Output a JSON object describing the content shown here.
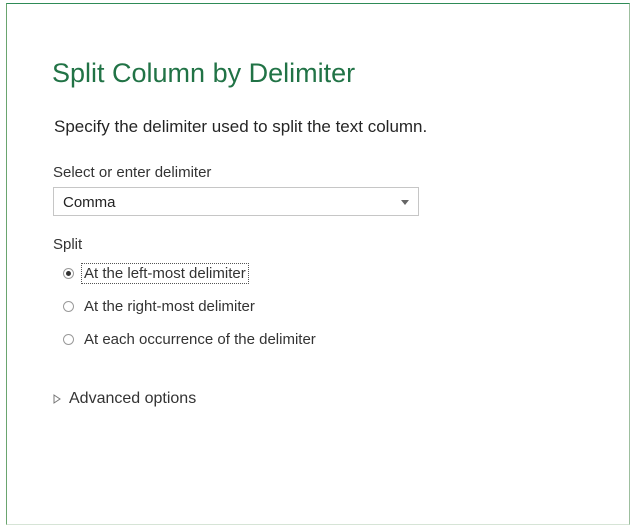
{
  "dialog": {
    "title": "Split Column by Delimiter",
    "description": "Specify the delimiter used to split the text column."
  },
  "delimiter": {
    "label": "Select or enter delimiter",
    "selected_value": "Comma"
  },
  "split": {
    "label": "Split",
    "options": [
      {
        "label": "At the left-most delimiter",
        "checked": true
      },
      {
        "label": "At the right-most delimiter",
        "checked": false
      },
      {
        "label": "At each occurrence of the delimiter",
        "checked": false
      }
    ]
  },
  "advanced": {
    "label": "Advanced options",
    "expanded": false
  },
  "colors": {
    "title": "#217346",
    "border_accent": "#2e8b57"
  },
  "icons": {
    "dropdown": "chevron-down-icon",
    "expander": "triangle-right-icon"
  }
}
